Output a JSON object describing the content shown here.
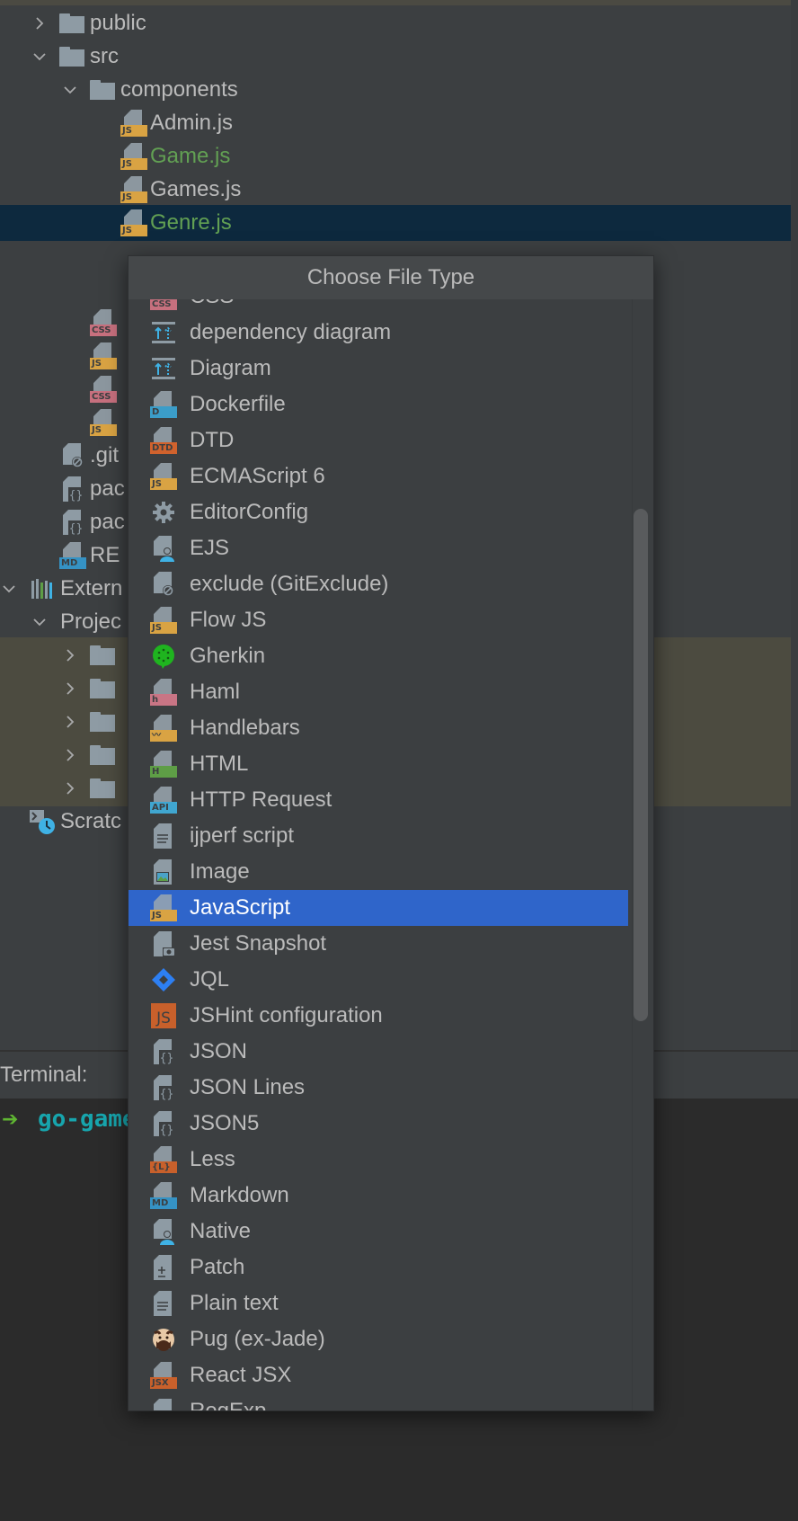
{
  "project_tree": {
    "rows": [
      {
        "label": "public",
        "type": "folder",
        "expanded": false,
        "indent": 0
      },
      {
        "label": "src",
        "type": "folder",
        "expanded": true,
        "indent": 0
      },
      {
        "label": "components",
        "type": "folder",
        "expanded": true,
        "indent": 1
      },
      {
        "label": "Admin.js",
        "type": "js",
        "status": "normal",
        "indent": 2
      },
      {
        "label": "Game.js",
        "type": "js",
        "status": "added",
        "indent": 2
      },
      {
        "label": "Games.js",
        "type": "js",
        "status": "normal",
        "indent": 2
      },
      {
        "label": "Genre.js",
        "type": "js",
        "status": "added",
        "indent": 2,
        "selected": true
      },
      {
        "label": "",
        "type": "css",
        "indent": 1
      },
      {
        "label": "",
        "type": "js",
        "indent": 1
      },
      {
        "label": "",
        "type": "css",
        "indent": 1
      },
      {
        "label": "",
        "type": "js",
        "indent": 1
      },
      {
        "label": ".git",
        "type": "gitignore",
        "indent": 0
      },
      {
        "label": "pac",
        "type": "json",
        "indent": 0
      },
      {
        "label": "pac",
        "type": "json",
        "indent": 0
      },
      {
        "label": "RE",
        "type": "md",
        "indent": 0
      },
      {
        "label": "Extern",
        "type": "libraries",
        "expanded": true,
        "indent": -1
      },
      {
        "label": "Projec",
        "type": "none",
        "expanded": true,
        "indent": 0
      },
      {
        "label": "",
        "type": "folder",
        "expanded": false,
        "indent": 1
      },
      {
        "label": "",
        "type": "folder",
        "expanded": false,
        "indent": 1
      },
      {
        "label": "",
        "type": "folder",
        "expanded": false,
        "indent": 1
      },
      {
        "label": "",
        "type": "folder",
        "expanded": false,
        "indent": 1
      },
      {
        "label": "",
        "type": "folder",
        "expanded": false,
        "indent": 1
      },
      {
        "label": "Scratc",
        "type": "scratches",
        "indent": -1
      }
    ]
  },
  "terminal": {
    "label": "Terminal:",
    "prompt_symbol": "➔",
    "prompt_dir": "go-game"
  },
  "popup": {
    "title": "Choose File Type",
    "selected_index": 17,
    "scroll_position_fraction": 0.35,
    "items": [
      {
        "label": "CSS",
        "icon": "css"
      },
      {
        "label": "dependency diagram",
        "icon": "diagram"
      },
      {
        "label": "Diagram",
        "icon": "diagram"
      },
      {
        "label": "Dockerfile",
        "icon": "docker"
      },
      {
        "label": "DTD",
        "icon": "dtd"
      },
      {
        "label": "ECMAScript 6",
        "icon": "js"
      },
      {
        "label": "EditorConfig",
        "icon": "gear"
      },
      {
        "label": "EJS",
        "icon": "person"
      },
      {
        "label": "exclude (GitExclude)",
        "icon": "gitignore"
      },
      {
        "label": "Flow JS",
        "icon": "js"
      },
      {
        "label": "Gherkin",
        "icon": "gherkin"
      },
      {
        "label": "Haml",
        "icon": "haml"
      },
      {
        "label": "Handlebars",
        "icon": "handlebars"
      },
      {
        "label": "HTML",
        "icon": "html"
      },
      {
        "label": "HTTP Request",
        "icon": "api"
      },
      {
        "label": "ijperf script",
        "icon": "text"
      },
      {
        "label": "Image",
        "icon": "image"
      },
      {
        "label": "JavaScript",
        "icon": "js"
      },
      {
        "label": "Jest Snapshot",
        "icon": "camera"
      },
      {
        "label": "JQL",
        "icon": "jql"
      },
      {
        "label": "JSHint configuration",
        "icon": "jshint"
      },
      {
        "label": "JSON",
        "icon": "json"
      },
      {
        "label": "JSON Lines",
        "icon": "json"
      },
      {
        "label": "JSON5",
        "icon": "json"
      },
      {
        "label": "Less",
        "icon": "less"
      },
      {
        "label": "Markdown",
        "icon": "md"
      },
      {
        "label": "Native",
        "icon": "person"
      },
      {
        "label": "Patch",
        "icon": "patch"
      },
      {
        "label": "Plain text",
        "icon": "text"
      },
      {
        "label": "Pug (ex-Jade)",
        "icon": "pug"
      },
      {
        "label": "React JSX",
        "icon": "jsx"
      },
      {
        "label": "RegExp",
        "icon": "regexp"
      }
    ]
  },
  "colors": {
    "selection_blue": "#2f65ca",
    "tree_selection": "#0d293e",
    "vcs_added_green": "#62a053",
    "olive_highlight": "#4c4b40",
    "terminal_cyan": "#17a5ad",
    "terminal_arrow_green": "#5fb532"
  }
}
